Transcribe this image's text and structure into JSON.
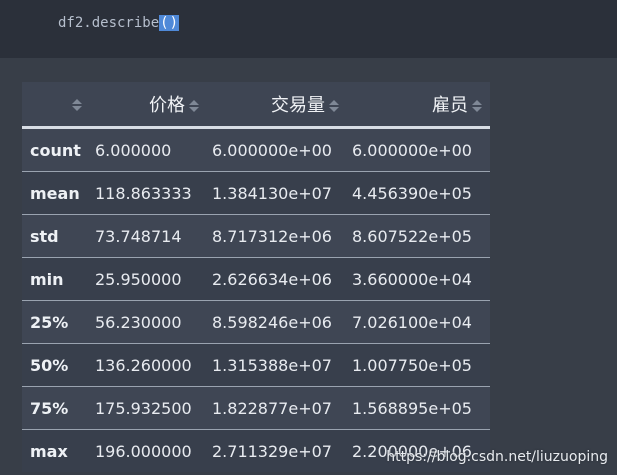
{
  "code": {
    "text": "df2.describe",
    "open_paren": "(",
    "close_paren": ")"
  },
  "table": {
    "columns": [
      "",
      "价格",
      "交易量",
      "雇员"
    ],
    "rows": [
      {
        "index": "count",
        "values": [
          "6.000000",
          "6.000000e+00",
          "6.000000e+00"
        ]
      },
      {
        "index": "mean",
        "values": [
          "118.863333",
          "1.384130e+07",
          "4.456390e+05"
        ]
      },
      {
        "index": "std",
        "values": [
          "73.748714",
          "8.717312e+06",
          "8.607522e+05"
        ]
      },
      {
        "index": "min",
        "values": [
          "25.950000",
          "2.626634e+06",
          "3.660000e+04"
        ]
      },
      {
        "index": "25%",
        "values": [
          "56.230000",
          "8.598246e+06",
          "7.026100e+04"
        ]
      },
      {
        "index": "50%",
        "values": [
          "136.260000",
          "1.315388e+07",
          "1.007750e+05"
        ]
      },
      {
        "index": "75%",
        "values": [
          "175.932500",
          "1.822877e+07",
          "1.568895e+05"
        ]
      },
      {
        "index": "max",
        "values": [
          "196.000000",
          "2.711329e+07",
          "2.200000e+06"
        ]
      }
    ]
  },
  "watermark": "https://blog.csdn.net/liuzuoping"
}
